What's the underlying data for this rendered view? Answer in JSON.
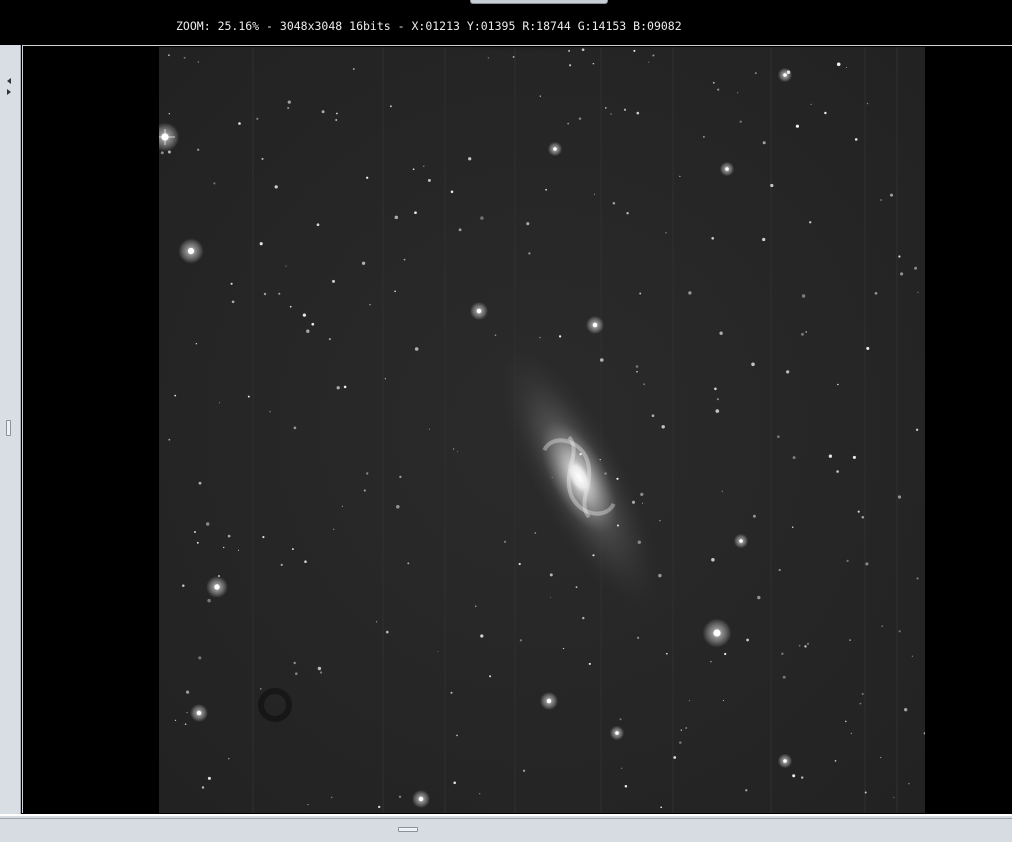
{
  "status": {
    "zoom_label": "ZOOM:",
    "zoom_value": "25.16%",
    "dimensions": "3048x3048",
    "bit_depth": "16bits",
    "x_label": "X:",
    "x_value": "01213",
    "y_label": "Y:",
    "y_value": "01395",
    "r_label": "R:",
    "r_value": "18744",
    "g_label": "G:",
    "g_value": "14153",
    "b_label": "B:",
    "b_value": "09082"
  },
  "side_panel": {
    "collapse_icon": "arrow-left-icon",
    "expand_icon": "arrow-right-icon"
  },
  "colors": {
    "background": "#000000",
    "sky": "#262626",
    "star": "#ffffff",
    "chrome": "#d9dee5",
    "status_text": "#ececec"
  }
}
